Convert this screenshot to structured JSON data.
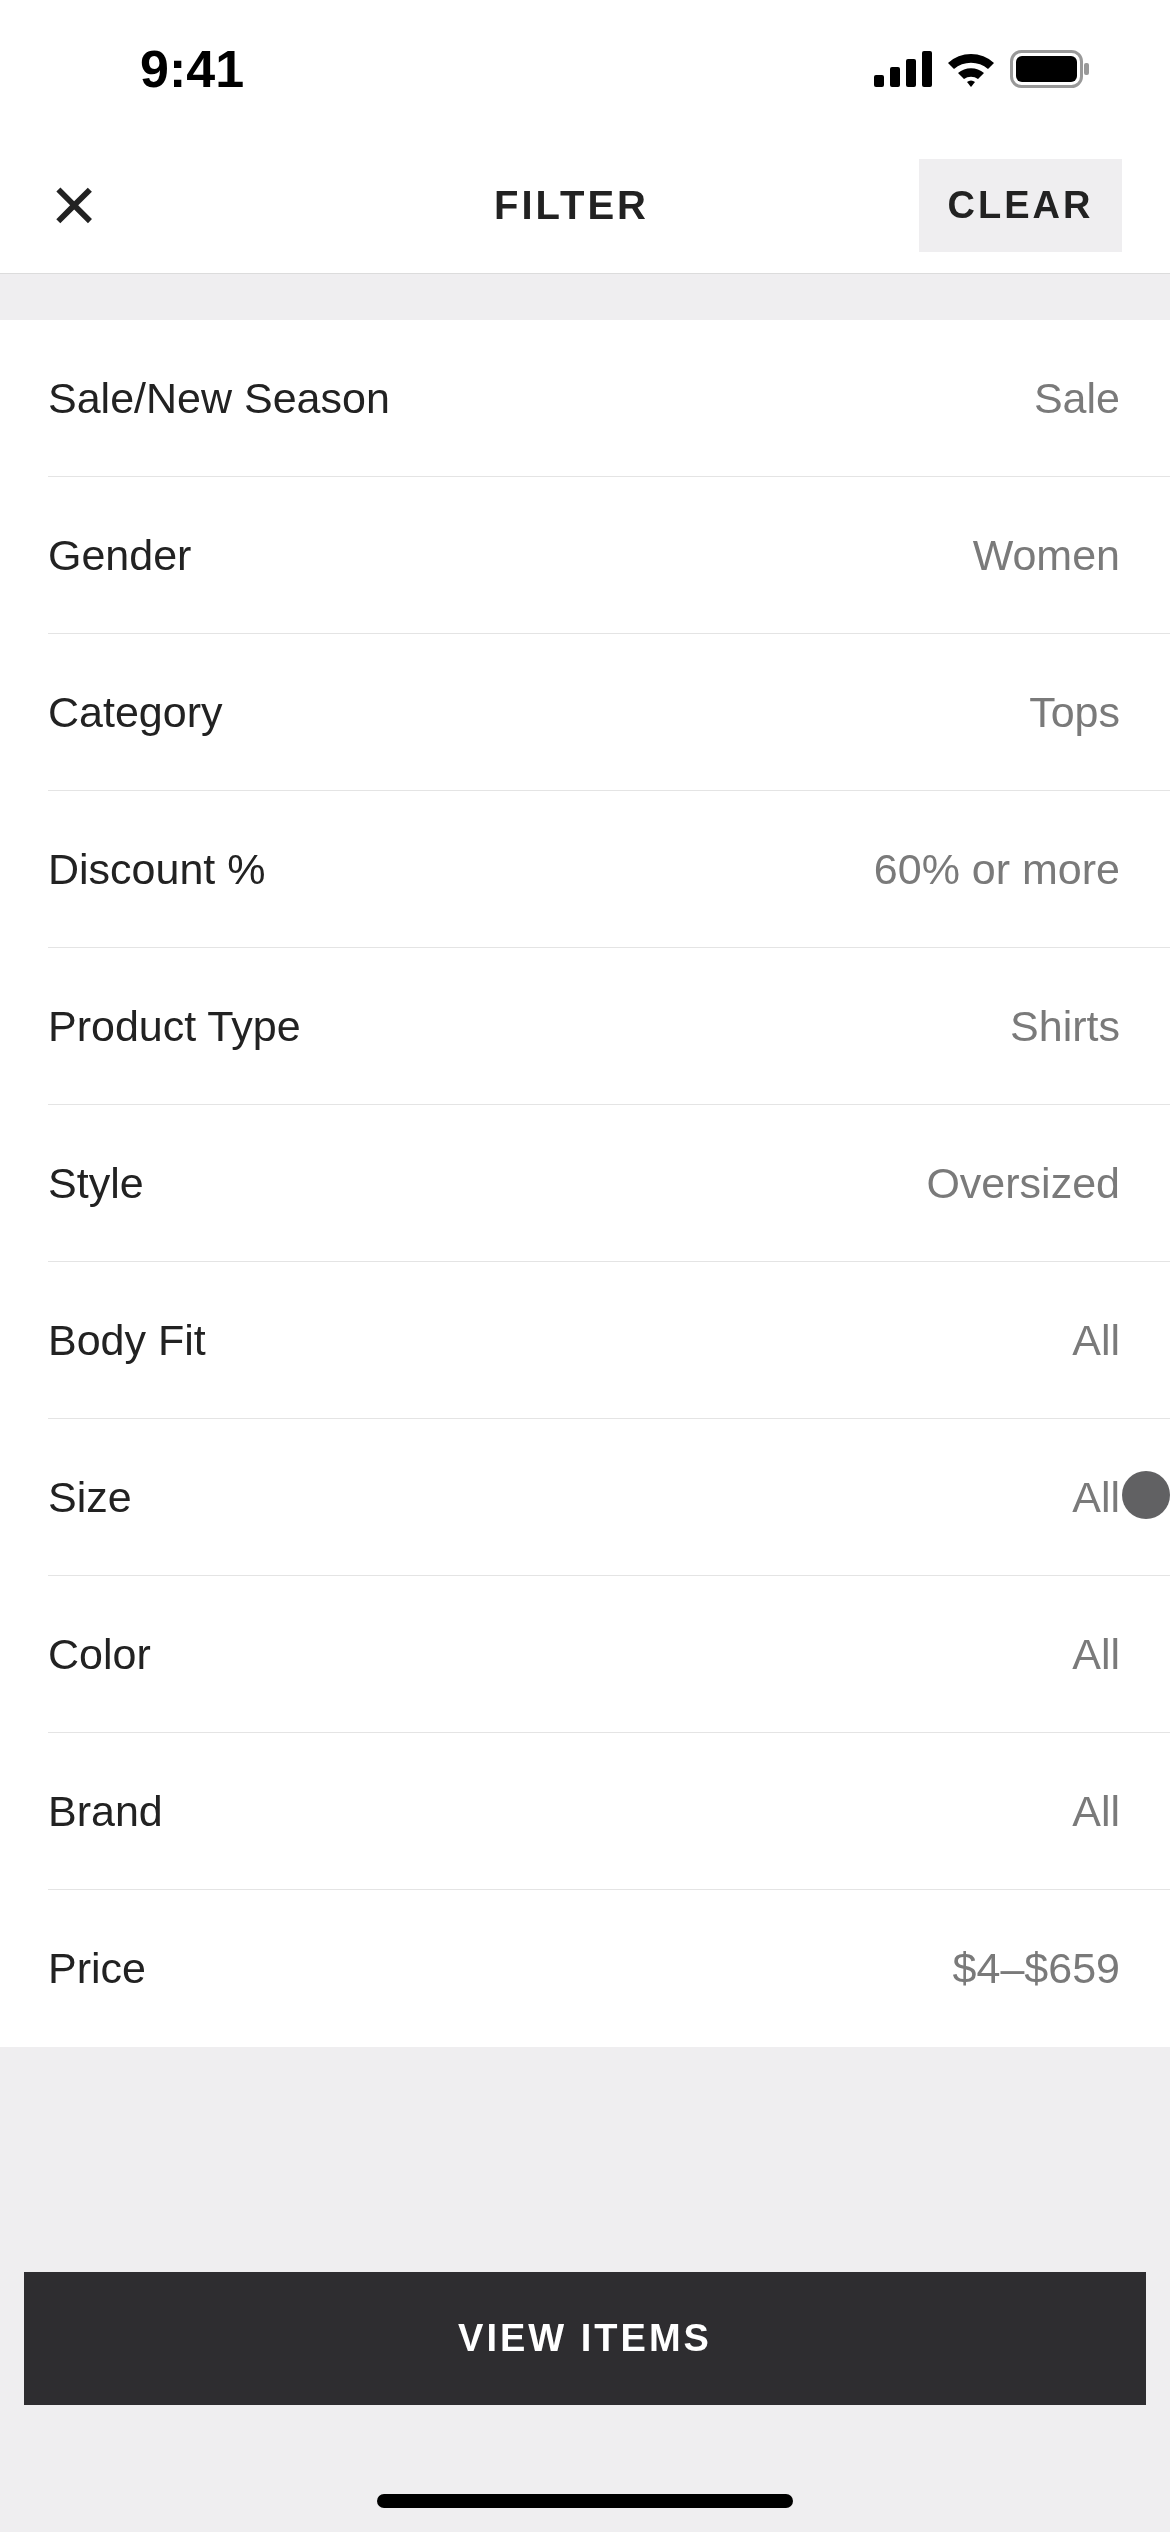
{
  "status_bar": {
    "time": "9:41"
  },
  "header": {
    "close": "×",
    "title": "FILTER",
    "clear_button": "CLEAR"
  },
  "filters": [
    {
      "label": "Sale/New Season",
      "value": "Sale",
      "touched": false
    },
    {
      "label": "Gender",
      "value": "Women",
      "touched": false
    },
    {
      "label": "Category",
      "value": "Tops",
      "touched": false
    },
    {
      "label": "Discount %",
      "value": "60% or more",
      "touched": false
    },
    {
      "label": "Product Type",
      "value": "Shirts",
      "touched": false
    },
    {
      "label": "Style",
      "value": "Oversized",
      "touched": false
    },
    {
      "label": "Body Fit",
      "value": "All",
      "touched": false
    },
    {
      "label": "Size",
      "value": "All",
      "touched": true
    },
    {
      "label": "Color",
      "value": "All",
      "touched": false
    },
    {
      "label": "Brand",
      "value": "All",
      "touched": false
    },
    {
      "label": "Price",
      "value": "$4–$659",
      "touched": false
    }
  ],
  "view_button": "VIEW ITEMS"
}
